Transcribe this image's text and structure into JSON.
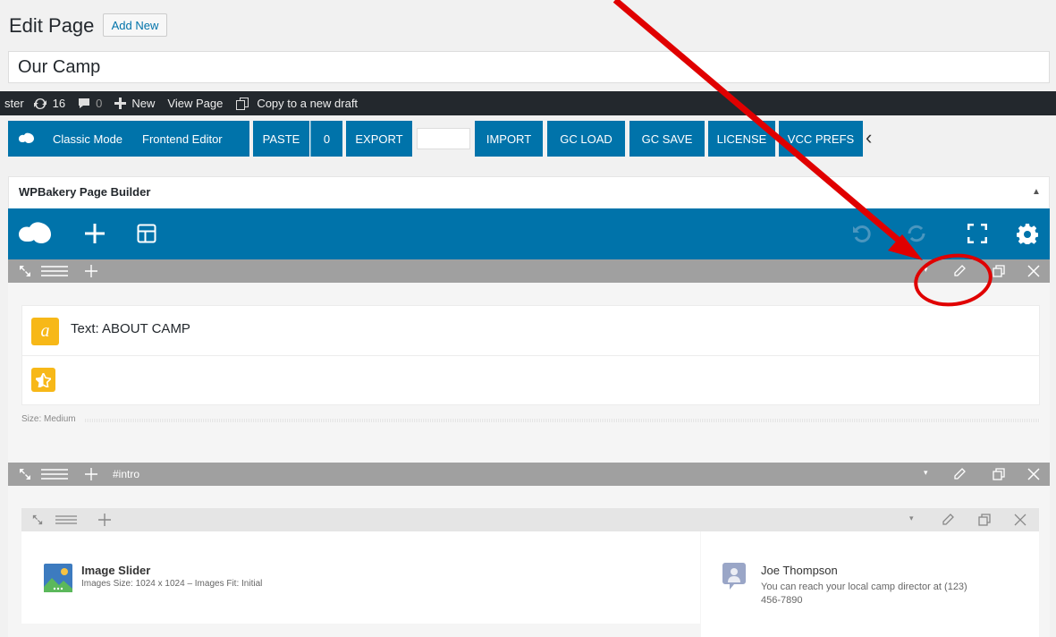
{
  "header": {
    "title": "Edit Page",
    "add_new": "Add New",
    "post_title": "Our Camp"
  },
  "adminbar": {
    "site_partial": "ster",
    "updates_count": "16",
    "comments_count": "0",
    "new_label": "New",
    "view_page": "View Page",
    "copy_draft": "Copy to a new draft"
  },
  "toolbar": {
    "classic_mode": "Classic Mode",
    "frontend_editor": "Frontend Editor",
    "paste": "PASTE",
    "paste_count": "0",
    "export": "EXPORT",
    "import": "IMPORT",
    "gc_load": "GC LOAD",
    "gc_save": "GC SAVE",
    "license": "LICENSE",
    "vcc_prefs": "VCC PREFS"
  },
  "builder": {
    "title": "WPBakery Page Builder"
  },
  "row1": {
    "text_element_label": "Text:",
    "text_element_value": "ABOUT CAMP",
    "size_label": "Size:",
    "size_value": "Medium"
  },
  "row2": {
    "row_id": "#intro"
  },
  "image_slider": {
    "title": "Image Slider",
    "size_label": "Images Size:",
    "size_value": "1024 x 1024",
    "sep": "–",
    "fit_label": "Images Fit:",
    "fit_value": "Initial"
  },
  "contact": {
    "name": "Joe Thompson",
    "text_line1": "You can reach your local camp director at (123)",
    "text_line2": "456-7890"
  },
  "colors": {
    "vc_blue": "#0073aa",
    "row_gray": "#a0a0a0",
    "annotation_red": "#e00000"
  }
}
